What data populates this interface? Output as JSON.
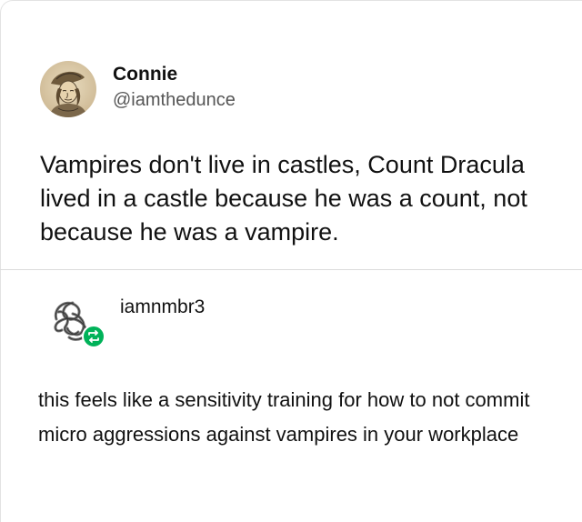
{
  "posts": [
    {
      "author": "Connie",
      "handle": "@iamthedunce",
      "text": "Vampires don't live in castles, Count Dracula lived in a castle because he was a count, not because he was a vampire."
    },
    {
      "author": "iamnmbr3",
      "text": "this feels like a sensitivity training for how to not commit micro aggressions against vampires in your workplace",
      "badge_icon": "reblog-icon",
      "badge_color": "#00b259"
    }
  ]
}
